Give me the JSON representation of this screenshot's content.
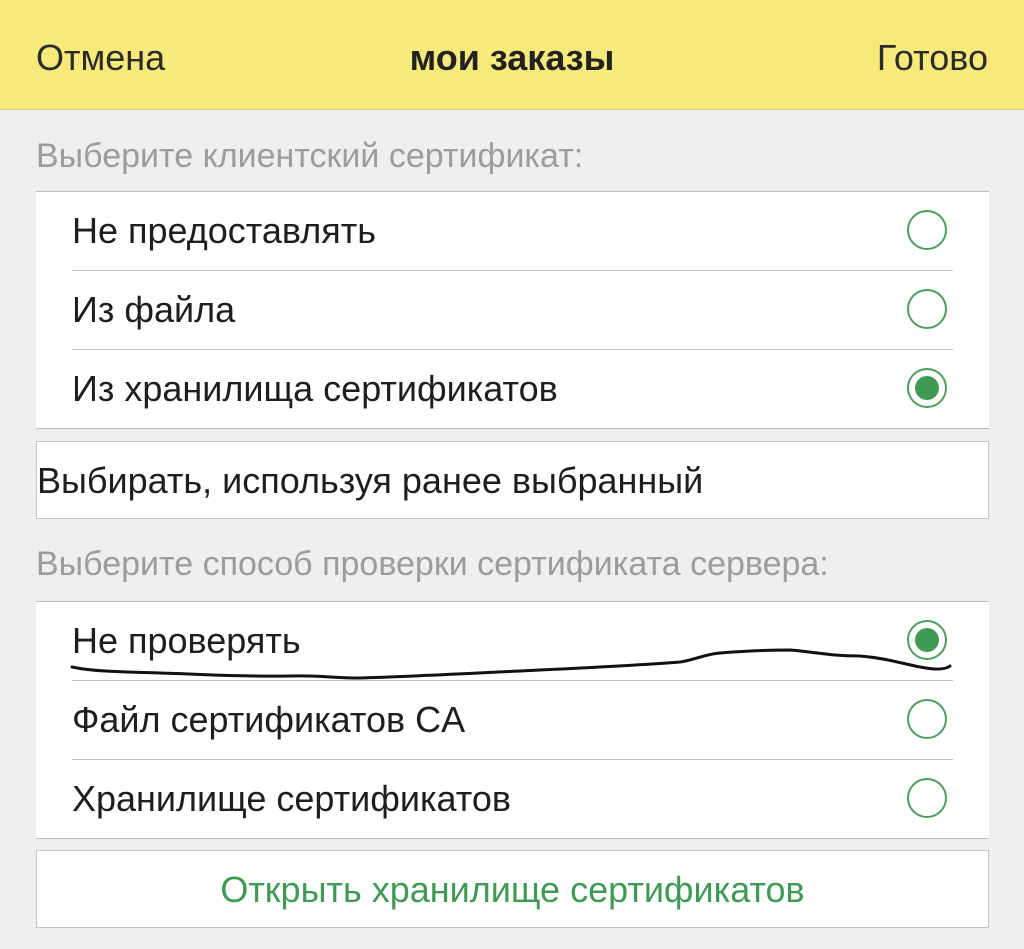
{
  "header": {
    "cancel_label": "Отмена",
    "title": "мои заказы",
    "done_label": "Готово"
  },
  "client_cert": {
    "section_label": "Выберите клиентский сертификат:",
    "options": [
      {
        "label": "Не предоставлять",
        "selected": false
      },
      {
        "label": "Из файла",
        "selected": false
      },
      {
        "label": "Из хранилища сертификатов",
        "selected": true
      }
    ],
    "choose_previous_label": "Выбирать, используя ранее выбранный"
  },
  "server_cert": {
    "section_label": "Выберите способ проверки сертификата сервера:",
    "options": [
      {
        "label": "Не проверять",
        "selected": true
      },
      {
        "label": "Файл сертификатов CA",
        "selected": false
      },
      {
        "label": "Хранилище сертификатов",
        "selected": false
      }
    ],
    "open_store_label": "Открыть хранилище сертификатов"
  },
  "colors": {
    "header_bg": "#f7e97a",
    "accent_green": "#3f9a53",
    "page_bg": "#efefef"
  }
}
